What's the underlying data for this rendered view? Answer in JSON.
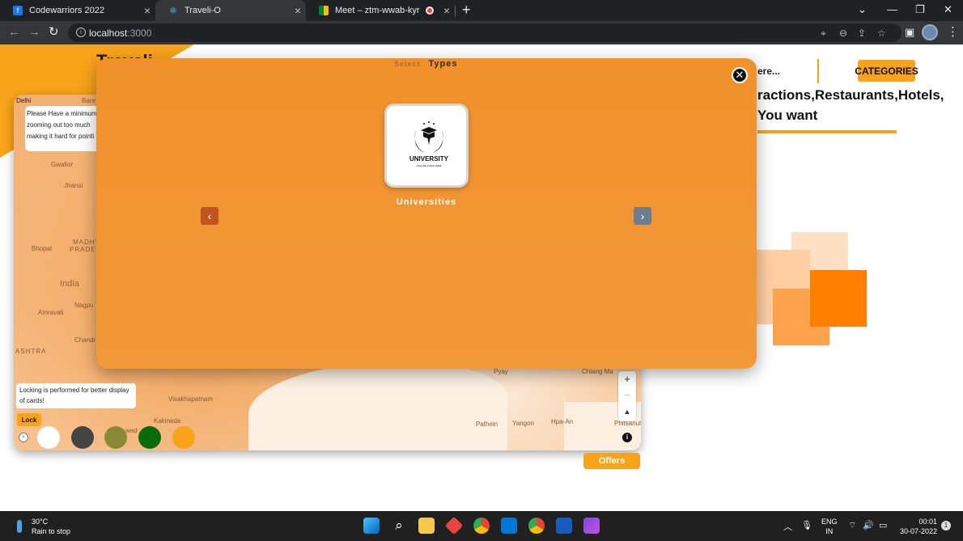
{
  "browser": {
    "tabs": [
      {
        "title": "Codewarriors 2022",
        "icon": "codewarriors-favicon"
      },
      {
        "title": "Traveli-O",
        "icon": "react-favicon"
      },
      {
        "title": "Meet – ztm-wwab-kyr",
        "icon": "meet-favicon"
      }
    ],
    "address": {
      "host": "localhost",
      "port": ":3000"
    }
  },
  "page": {
    "brand": "Traveli",
    "search_placeholder_partial": "ere...",
    "categories_label": "CATEGORIES",
    "headline_line1": "ractions,Restaurants,Hotels,",
    "headline_line2": "You want",
    "offers_label": "Offers",
    "colors": {
      "accent": "#f9a31b",
      "modal": "#f0912a"
    }
  },
  "map": {
    "labels": {
      "delhi": "Delhi",
      "bareilly": "Bare",
      "gwalior": "Gwalior",
      "jhansi": "Jhansi",
      "bhopal": "Bhopal",
      "madhya": "MADHYA",
      "pradesh": "PRADESH",
      "india": "India",
      "nagpur": "Nagpu",
      "amravati": "Amravati",
      "chandrapur": "Chandr",
      "ashtra": "ASHTRA",
      "visakhapatnam": "Visakhapatnam",
      "kakinada": "Kakinada",
      "vijayawada": "wad",
      "pathein": "Pathein",
      "yangon": "Yangon",
      "hpaan": "Hpa-An",
      "phitsanulok": "Phitsanul",
      "pyay": "Pyay",
      "chiangmai": "Chiang Ma"
    },
    "zoom_warning": "Please Have a minimum zooming out too much making it hard for pointi",
    "lock_note": "Locking is performed for better display of cards!",
    "lock_label": "Lock",
    "zoom_in": "+",
    "zoom_out": "−",
    "compass": "▲",
    "swatches": [
      "#ffffff",
      "#444444",
      "#8a8a35",
      "#0a6b0a",
      "#f9a31b"
    ]
  },
  "modal": {
    "title_prefix": "Select",
    "title": "Types",
    "card_label": "Universities",
    "card_logo_text": "UNIVERSITY",
    "card_logo_subtext": "TAGLINE GOES HERE",
    "close_glyph": "✕",
    "prev_glyph": "‹",
    "next_glyph": "›"
  },
  "taskbar": {
    "weather_temp": "30°C",
    "weather_desc": "Rain to stop",
    "lang_line1": "ENG",
    "lang_line2": "IN",
    "time": "00:01",
    "date": "30-07-2022",
    "notifications": "1"
  }
}
